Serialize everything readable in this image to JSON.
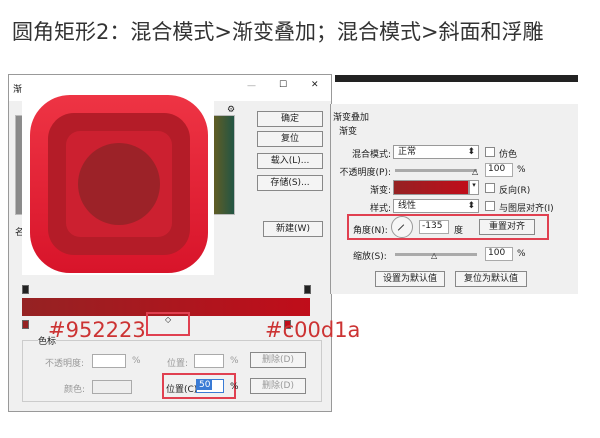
{
  "title": "圆角矩形2：混合模式>渐变叠加；混合模式>斜面和浮雕",
  "colors": {
    "gradient_start": "#952223",
    "gradient_end": "#c00d1a",
    "annotation": "#cc3333"
  },
  "left_dialog": {
    "title_partial": "渐",
    "name_label_partial": "名",
    "buttons": {
      "ok": "确定",
      "reset": "复位",
      "load": "载入(L)...",
      "save": "存储(S)...",
      "new": "新建(W)"
    },
    "gear_icon": "gear-icon",
    "window_controls": {
      "minimize": "—",
      "maximize": "☐",
      "close": "✕"
    },
    "gradient_start_hex": "#952223",
    "gradient_end_hex": "#c00d1a",
    "color_stops": {
      "group_label": "色标",
      "opacity_label": "不透明度:",
      "opacity_unit": "%",
      "position_label": "位置:",
      "position_unit": "%",
      "delete1": "删除(D)",
      "color_label": "颜色:",
      "position2_label": "位置(C):",
      "position2_value": "50",
      "position2_unit": "%",
      "delete2": "删除(D)"
    }
  },
  "right_panel": {
    "section": "渐变叠加",
    "group": "渐变",
    "blend_label": "混合模式:",
    "blend_value": "正常",
    "dither_label": "仿色",
    "opacity_label": "不透明度(P):",
    "opacity_value": "100",
    "opacity_unit": "%",
    "opacity_level": 100,
    "gradient_label": "渐变:",
    "reverse_label": "反向(R)",
    "style_label": "样式:",
    "style_value": "线性",
    "align_label": "与图层对齐(I)",
    "angle_label": "角度(N):",
    "angle_value": "-135",
    "angle_unit": "度",
    "reset_align": "重置对齐",
    "scale_label": "缩放(S):",
    "scale_value": "100",
    "scale_unit": "%",
    "scale_level": 100,
    "set_default": "设置为默认值",
    "reset_default": "复位为默认值"
  }
}
